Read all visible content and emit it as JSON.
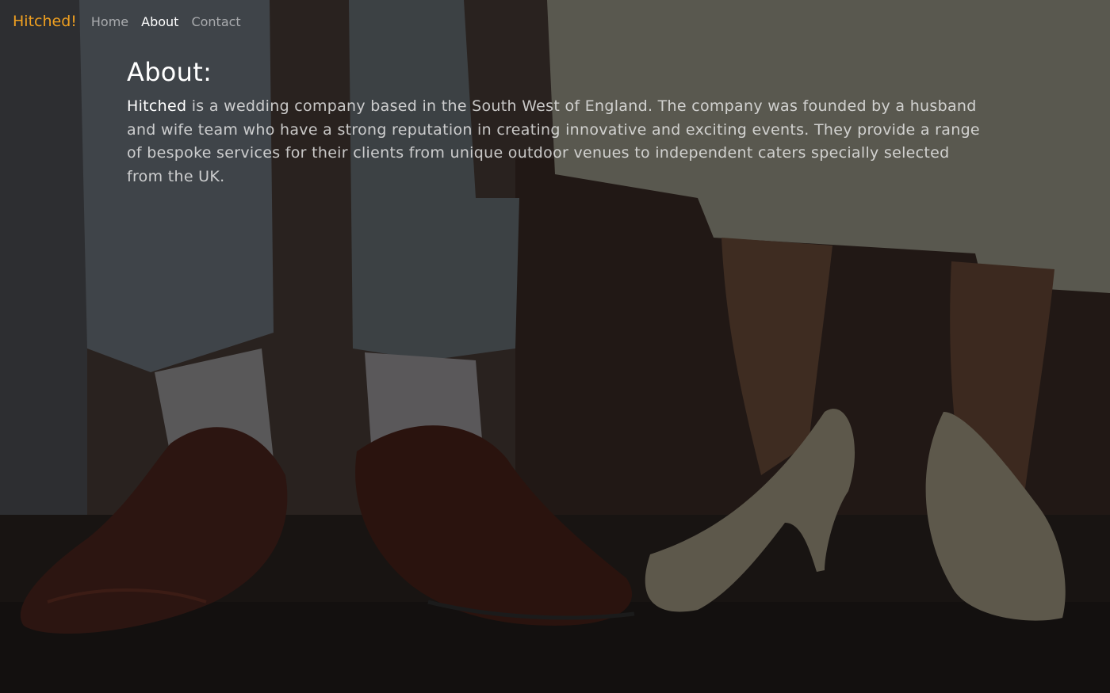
{
  "navbar": {
    "brand": "Hitched!",
    "links": [
      {
        "label": "Home",
        "active": false
      },
      {
        "label": "About",
        "active": true
      },
      {
        "label": "Contact",
        "active": false
      }
    ]
  },
  "about": {
    "heading": "About:",
    "lead_word": "Hitched",
    "body": " is a wedding company based in the South West of England. The company was founded by a husband and wife team who have a strong reputation in creating innovative and exciting events. They provide a range of bespoke services for their clients from unique outdoor venues to independent caters specially selected from the UK."
  },
  "colors": {
    "brand": "#f0a020",
    "nav_link": "rgba(255,255,255,0.55)",
    "nav_link_active": "#ffffff",
    "overlay": "rgba(20,20,20,0.42)"
  },
  "background_image": {
    "subject": "wedding-couple-shoes-photo"
  }
}
